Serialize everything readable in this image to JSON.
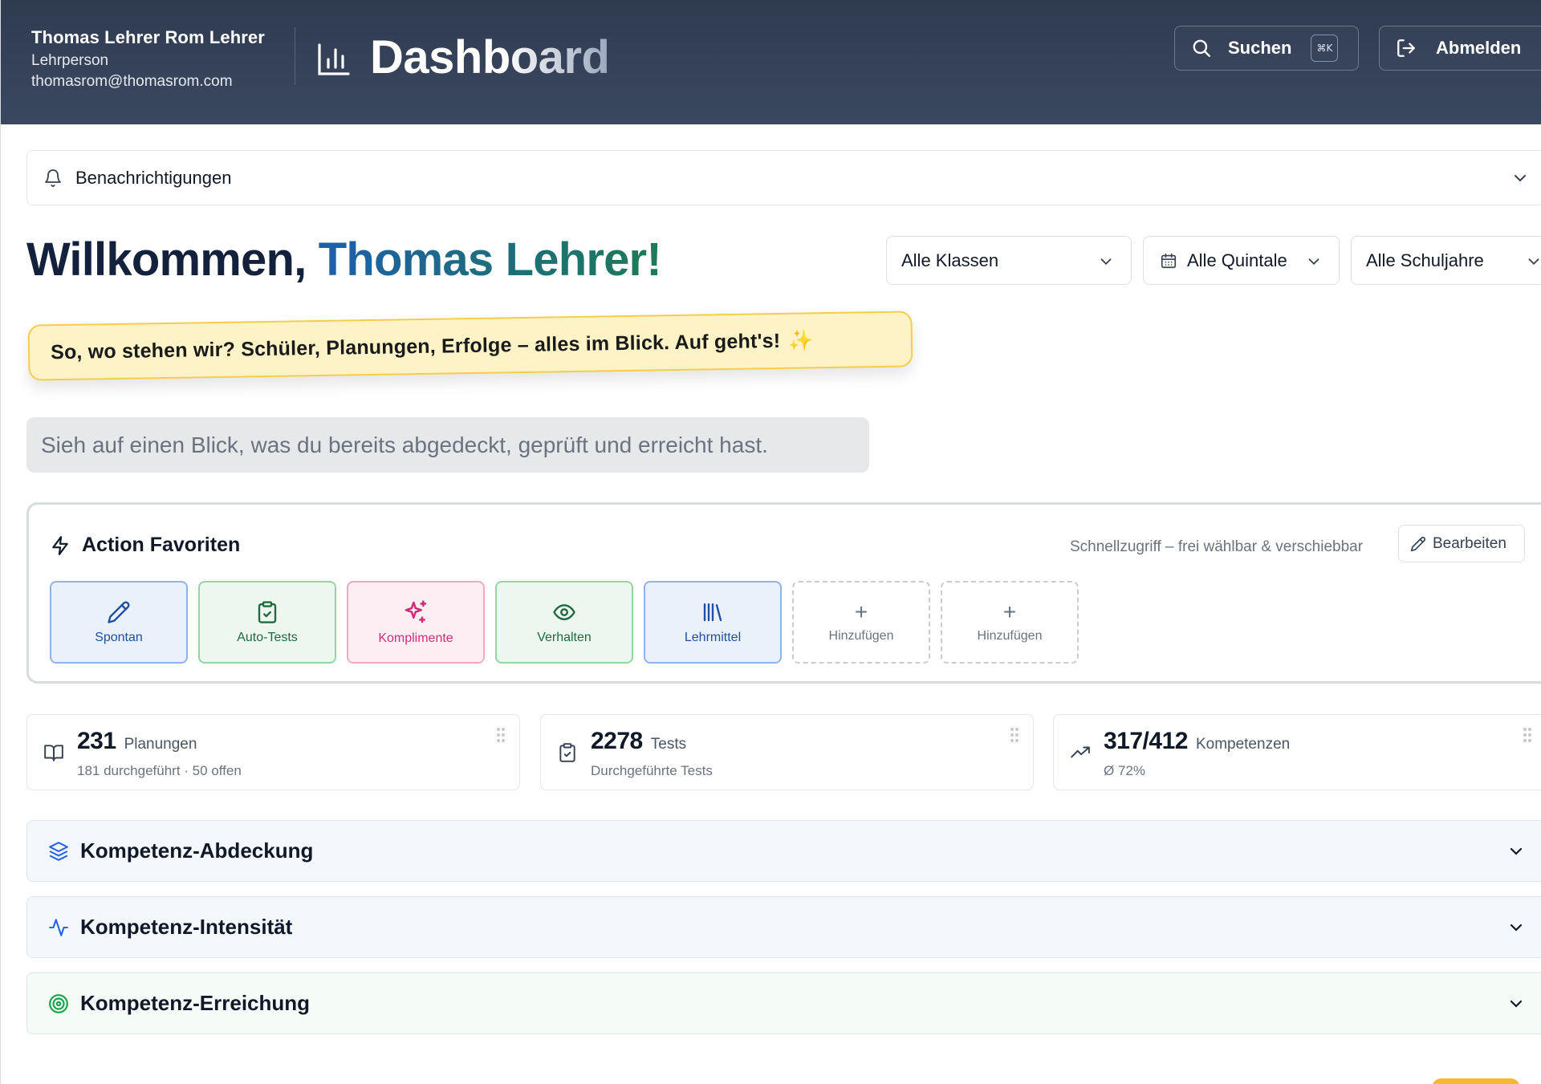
{
  "header": {
    "user_name": "Thomas Lehrer Rom Lehrer",
    "user_role": "Lehrperson",
    "user_email": "thomasrom@thomasrom.com",
    "title": "Dashboard",
    "search_label": "Suchen",
    "search_shortcut": "⌘K",
    "logout_label": "Abmelden"
  },
  "notifications": {
    "label": "Benachrichtigungen"
  },
  "welcome": {
    "prefix": "Willkommen, ",
    "name": "Thomas Lehrer!",
    "note": "So, wo stehen wir? Schüler, Planungen, Erfolge – alles im Blick. Auf geht's!",
    "note_emoji": "✨",
    "subtitle": "Sieh auf einen Blick, was du bereits abgedeckt, geprüft und erreicht hast."
  },
  "filters": {
    "classes": "Alle Klassen",
    "quintals": "Alle Quintale",
    "school_years": "Alle Schuljahre"
  },
  "favorites": {
    "title": "Action Favoriten",
    "hint": "Schnellzugriff – frei wählbar & verschiebbar",
    "edit_label": "Bearbeiten",
    "tiles": [
      {
        "label": "Spontan",
        "icon": "pencil-icon"
      },
      {
        "label": "Auto-Tests",
        "icon": "clipboard-check-icon"
      },
      {
        "label": "Komplimente",
        "icon": "sparkles-icon"
      },
      {
        "label": "Verhalten",
        "icon": "eye-icon"
      },
      {
        "label": "Lehrmittel",
        "icon": "library-icon"
      },
      {
        "label": "Hinzufügen",
        "icon": "plus-icon"
      },
      {
        "label": "Hinzufügen",
        "icon": "plus-icon"
      }
    ],
    "plus_symbol": "+"
  },
  "stats": [
    {
      "value": "231",
      "unit": "Planungen",
      "sub": "181 durchgeführt · 50 offen",
      "icon": "book-open-icon"
    },
    {
      "value": "2278",
      "unit": "Tests",
      "sub": "Durchgeführte Tests",
      "icon": "clipboard-icon"
    },
    {
      "value": "317/412",
      "unit": "Kompetenzen",
      "sub": "Ø 72%",
      "icon": "trending-up-icon"
    }
  ],
  "sections": [
    {
      "label": "Kompetenz-Abdeckung",
      "icon": "layers-icon"
    },
    {
      "label": "Kompetenz-Intensität",
      "icon": "activity-icon"
    },
    {
      "label": "Kompetenz-Erreichung",
      "icon": "target-icon"
    }
  ],
  "colors": {
    "header_bg": "#2f3b4f",
    "accent_blue": "#1d5fa8",
    "accent_green": "#1e7a55",
    "pink": "#d02d76",
    "note_bg": "#fef2c7",
    "note_border": "#f5cd4d"
  }
}
